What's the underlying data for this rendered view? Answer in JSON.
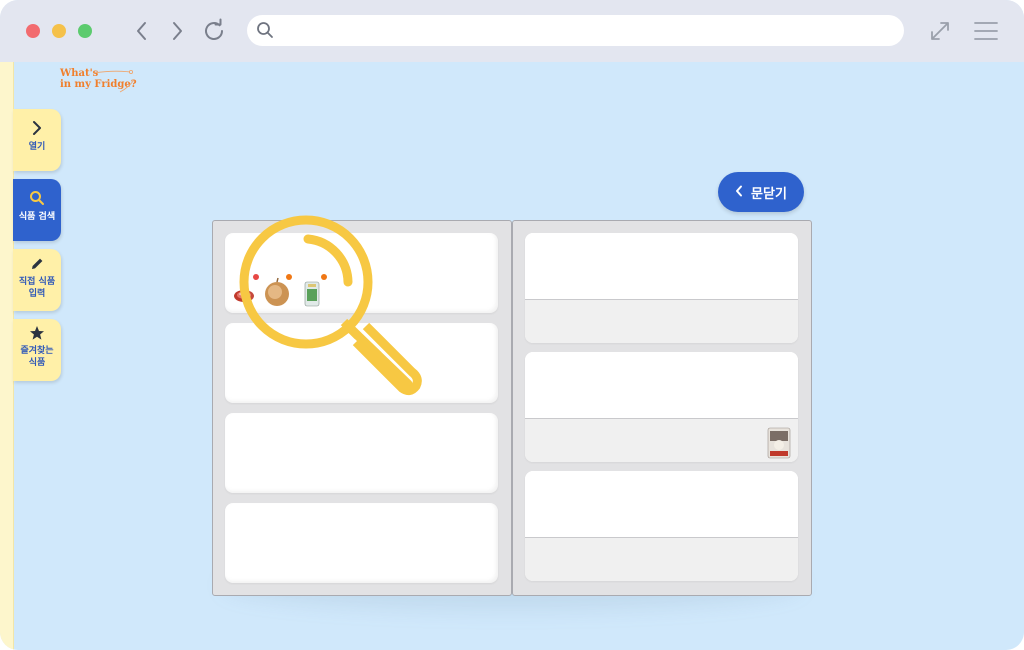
{
  "browser": {
    "address_value": "",
    "address_placeholder": "",
    "icons": [
      "chevron-left-icon",
      "chevron-right-icon",
      "reload-icon",
      "search-icon",
      "expand-icon",
      "menu-icon"
    ]
  },
  "logo": {
    "line1": "What's",
    "line2": "in my Fridge?"
  },
  "sidebar": {
    "items": [
      {
        "label": "열기",
        "icon": "chevron-right-icon",
        "active": false
      },
      {
        "label": "식품 검색",
        "icon": "search-icon",
        "active": true
      },
      {
        "label_line1": "직접 식품",
        "label_line2": "입력",
        "icon": "pencil-icon",
        "active": false
      },
      {
        "label_line1": "즐겨찾는",
        "label_line2": "식품",
        "icon": "star-icon",
        "active": false
      }
    ]
  },
  "close_door": {
    "label": "문닫기",
    "icon": "chevron-left-icon"
  },
  "fridge": {
    "left_door_shelves": 4,
    "right_door_shelves": 3,
    "foods": [
      {
        "name": "meat",
        "shelf": "left-1",
        "badge_color": "#e53935"
      },
      {
        "name": "onion",
        "shelf": "left-1",
        "badge_color": "#ef6c00"
      },
      {
        "name": "drink-can",
        "shelf": "left-1",
        "badge_color": "#ef6c00"
      },
      {
        "name": "packaged-food",
        "shelf": "right-2"
      }
    ]
  },
  "colors": {
    "background": "#d0e8fb",
    "accent": "#2f62cd",
    "tab": "#fff0a8",
    "magnifier": "#f7c843"
  }
}
